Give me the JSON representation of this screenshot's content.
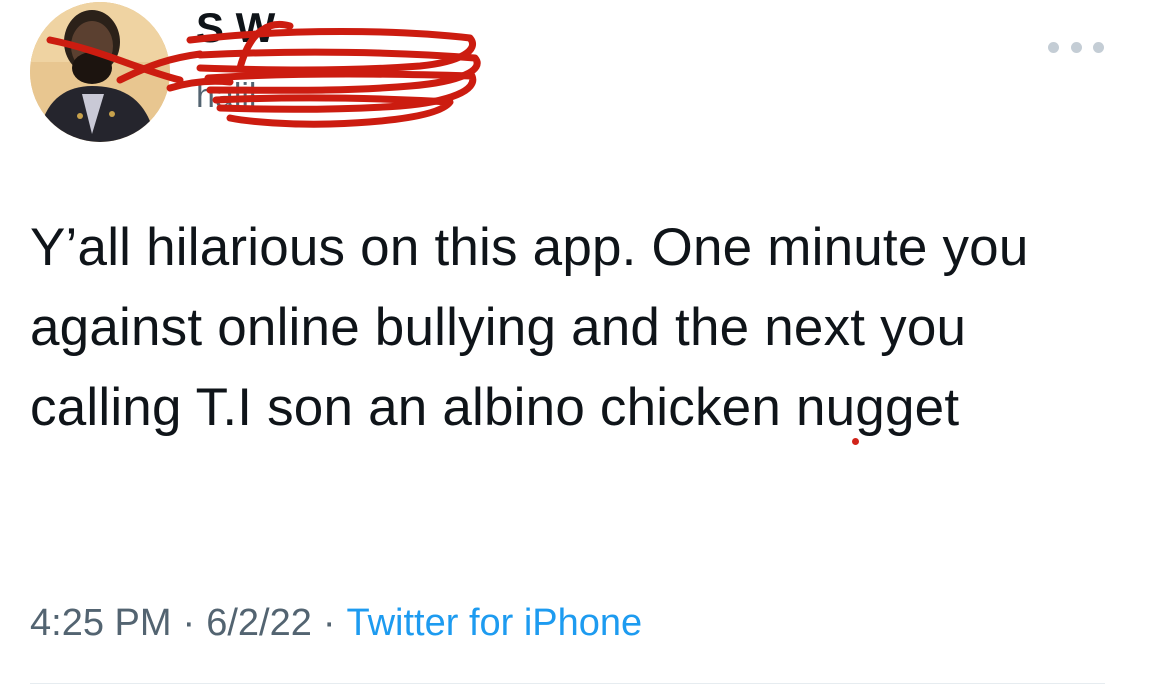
{
  "author": {
    "display_name": "S W",
    "handle": "halil"
  },
  "tweet": {
    "text": "Y’all hilarious on this app. One minute you against online bullying and the next you calling T.I son an albino chicken nugget"
  },
  "meta": {
    "time": "4:25 PM",
    "separator": "·",
    "date": "6/2/22",
    "source": "Twitter for iPhone"
  },
  "icons": {
    "more": "more-horizontal-icon"
  },
  "colors": {
    "text": "#0f1419",
    "secondary": "#536471",
    "link": "#1d9bf0",
    "redaction": "#cc1c10"
  }
}
